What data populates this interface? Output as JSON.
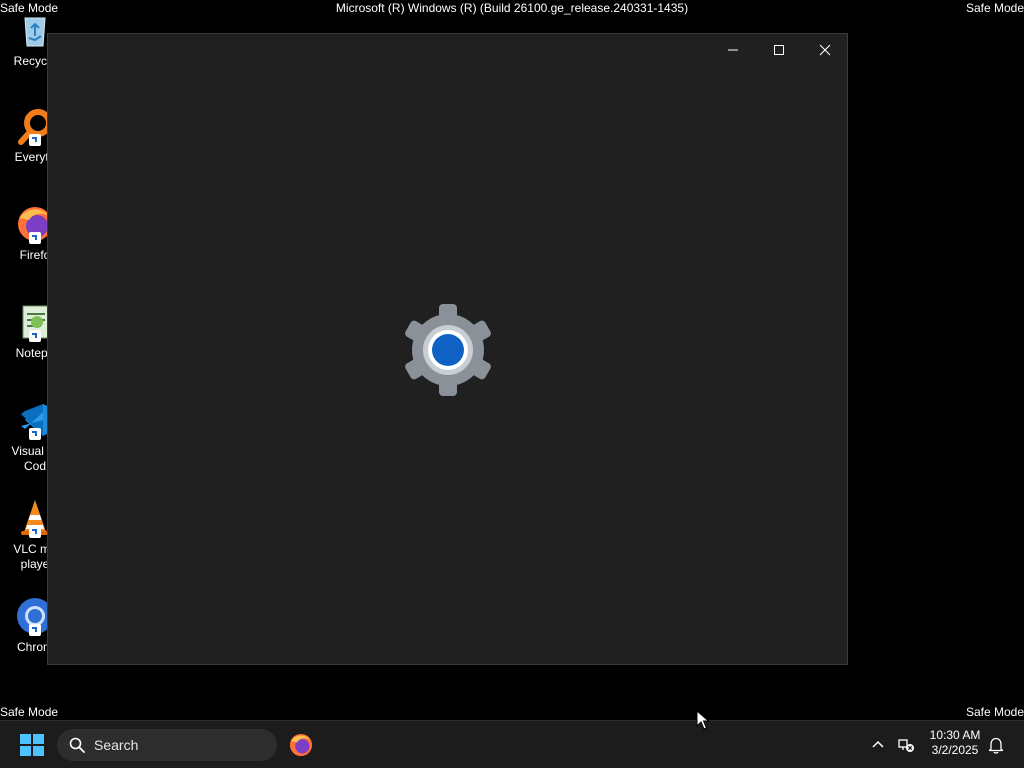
{
  "desktop": {
    "safe_mode_label": "Safe Mode",
    "build_string": "Microsoft (R) Windows (R) (Build 26100.ge_release.240331-1435)",
    "icons": [
      {
        "label": "Recycle",
        "icon": "recycle-bin-icon"
      },
      {
        "label": "Everyth",
        "icon": "everything-search-icon"
      },
      {
        "label": "Firefo",
        "icon": "firefox-icon"
      },
      {
        "label": "Notepa",
        "icon": "notepad-icon"
      },
      {
        "label": "Visual St\nCod",
        "icon": "vscode-icon"
      },
      {
        "label": "VLC me\nplaye",
        "icon": "vlc-icon"
      },
      {
        "label": "Chrom",
        "icon": "chrome-icon"
      }
    ]
  },
  "window": {
    "title": "",
    "controls": [
      "minimize",
      "maximize",
      "close"
    ],
    "splash_icon": "settings-gear-icon",
    "accent": "#0f62c4"
  },
  "taskbar": {
    "search_placeholder": "Search",
    "pinned": [
      "firefox-icon"
    ],
    "clock_time": "10:30 AM",
    "clock_date": "3/2/2025"
  }
}
